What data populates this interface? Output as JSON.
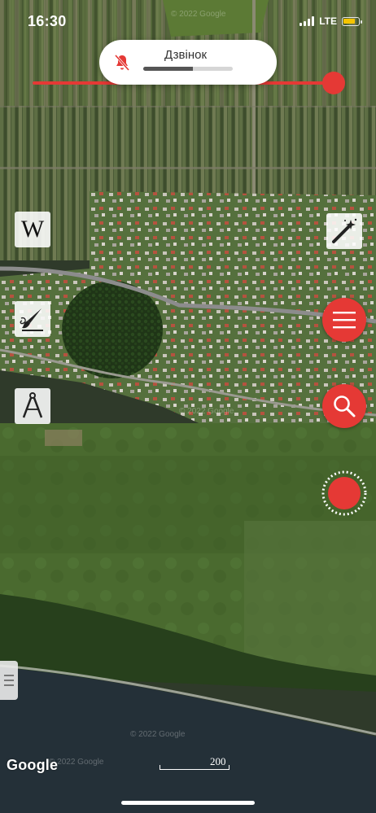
{
  "status_bar": {
    "time": "16:30",
    "network": "LTE",
    "battery_level": 0.85,
    "signal_bars": 4
  },
  "volume_hud": {
    "label": "Дзвінок",
    "level": 0.55,
    "icon": "bell-slash-icon"
  },
  "tools": {
    "wikipedia": {
      "letter": "W",
      "icon": "wikipedia-icon"
    },
    "draw": {
      "icon": "brush-icon"
    },
    "measure": {
      "icon": "compass-icon"
    },
    "magic": {
      "icon": "magic-wand-icon"
    }
  },
  "buttons": {
    "menu_icon": "menu-icon",
    "search_icon": "search-icon",
    "record_icon": "record-icon"
  },
  "map": {
    "attribution": "Google",
    "watermarks": [
      "© 2022 Google",
      "© 2022 Google",
      "© 2022 Google",
      "© 2022 Google"
    ],
    "scale_label": "200"
  },
  "colors": {
    "accent": "#e53935",
    "battery": "#f5c400"
  }
}
